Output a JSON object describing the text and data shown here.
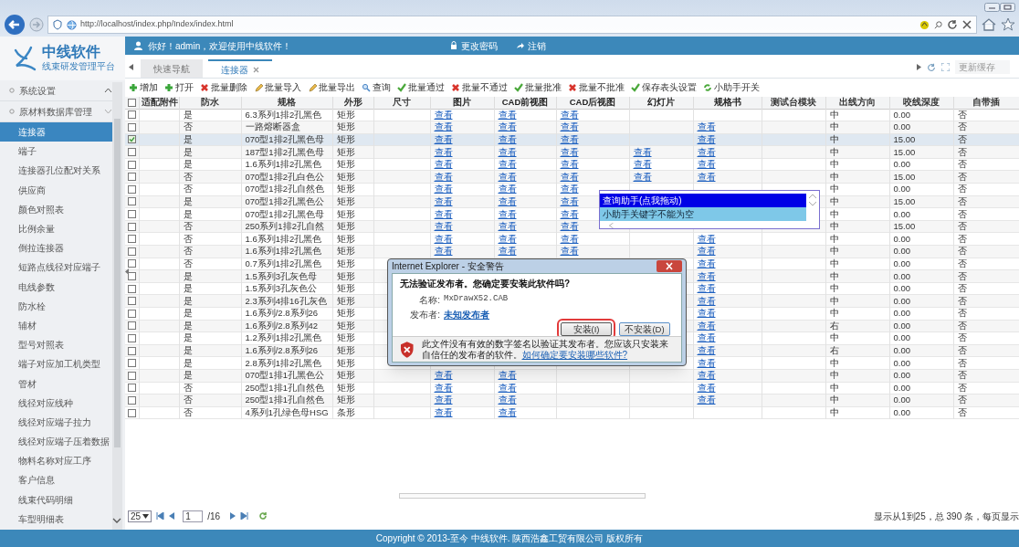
{
  "browser": {
    "url": "http://localhost/index.php/Index/index.html"
  },
  "app": {
    "name": "中线软件",
    "subtitle": "线束研发管理平台"
  },
  "top_bar": {
    "greeting": "你好！admin，欢迎使用中线软件！",
    "links": [
      {
        "label": "更改密码",
        "kind": "password"
      },
      {
        "label": "注销",
        "kind": "logout"
      }
    ]
  },
  "sidebar": {
    "groups": [
      {
        "label": "系统设置",
        "expanded": false
      },
      {
        "label": "原材料数据库管理",
        "expanded": true,
        "children": [
          {
            "label": "连接器",
            "selected": true
          },
          {
            "label": "端子",
            "selected": false
          },
          {
            "label": "连接器孔位配对关系",
            "selected": false
          },
          {
            "label": "供应商",
            "selected": false
          },
          {
            "label": "颜色对照表",
            "selected": false
          },
          {
            "label": "比例余量",
            "selected": false
          },
          {
            "label": "倒拉连接器",
            "selected": false
          },
          {
            "label": "短路点线径对应端子",
            "selected": false
          },
          {
            "label": "电线参数",
            "selected": false
          },
          {
            "label": "防水栓",
            "selected": false
          },
          {
            "label": "辅材",
            "selected": false
          },
          {
            "label": "型号对照表",
            "selected": false
          },
          {
            "label": "端子对应加工机类型",
            "selected": false
          },
          {
            "label": "管材",
            "selected": false
          },
          {
            "label": "线径对应线种",
            "selected": false
          },
          {
            "label": "线径对应端子拉力",
            "selected": false
          },
          {
            "label": "线径对应端子压着数据",
            "selected": false
          },
          {
            "label": "物料名称对应工序",
            "selected": false
          },
          {
            "label": "客户信息",
            "selected": false
          },
          {
            "label": "线束代码明细",
            "selected": false
          },
          {
            "label": "车型明细表",
            "selected": false
          }
        ]
      }
    ]
  },
  "tabs": [
    {
      "label": "快速导航",
      "selected": false,
      "closable": false
    },
    {
      "label": "连接器",
      "selected": true,
      "closable": true
    }
  ],
  "tab_tools": {
    "cache_label": "更新缓存"
  },
  "toolbar": [
    {
      "label": "增加",
      "kind": "add"
    },
    {
      "label": "打开",
      "kind": "add"
    },
    {
      "label": "批量删除",
      "kind": "reject"
    },
    {
      "label": "批量导入",
      "kind": "edit"
    },
    {
      "label": "批量导出",
      "kind": "edit"
    },
    {
      "label": "查询",
      "kind": "query"
    },
    {
      "label": "批量通过",
      "kind": "accept"
    },
    {
      "label": "批量不通过",
      "kind": "reject"
    },
    {
      "label": "批量批准",
      "kind": "accept"
    },
    {
      "label": "批量不批准",
      "kind": "reject"
    },
    {
      "label": "保存表头设置",
      "kind": "accept"
    },
    {
      "label": "小助手开关",
      "kind": "toggle"
    }
  ],
  "table": {
    "select_all_checked": false,
    "columns": [
      {
        "label": "适配附件",
        "kind": "text"
      },
      {
        "label": "防水",
        "kind": "text"
      },
      {
        "label": "规格",
        "kind": "text"
      },
      {
        "label": "外形",
        "kind": "text"
      },
      {
        "label": "尺寸",
        "kind": "text"
      },
      {
        "label": "图片",
        "kind": "link"
      },
      {
        "label": "CAD前视图",
        "kind": "link"
      },
      {
        "label": "CAD后视图",
        "kind": "link"
      },
      {
        "label": "幻灯片",
        "kind": "link"
      },
      {
        "label": "规格书",
        "kind": "link"
      },
      {
        "label": "测试台模块",
        "kind": "text"
      },
      {
        "label": "出线方向",
        "kind": "text"
      },
      {
        "label": "咬线深度",
        "kind": "text"
      },
      {
        "label": "自带插",
        "kind": "text"
      }
    ],
    "rows": [
      {
        "checked": false,
        "cells": [
          null,
          "是",
          "6.3系列1排2孔黑色",
          "矩形",
          null,
          "查看",
          "查看",
          "查看",
          null,
          null,
          null,
          "中",
          "0.00",
          "否"
        ]
      },
      {
        "checked": false,
        "cells": [
          null,
          "否",
          "一路熔断器盒",
          "矩形",
          null,
          "查看",
          "查看",
          "查看",
          null,
          "查看",
          null,
          "中",
          "0.00",
          "否"
        ]
      },
      {
        "checked": true,
        "cells": [
          null,
          "是",
          "070型1排2孔黑色母",
          "矩形",
          null,
          "查看",
          "查看",
          "查看",
          null,
          "查看",
          null,
          "中",
          "15.00",
          "否"
        ]
      },
      {
        "checked": false,
        "cells": [
          null,
          "是",
          "187型1排2孔黑色母",
          "矩形",
          null,
          "查看",
          "查看",
          "查看",
          "查看",
          "查看",
          null,
          "中",
          "15.00",
          "否"
        ]
      },
      {
        "checked": false,
        "cells": [
          null,
          "是",
          "1.6系列1排2孔黑色",
          "矩形",
          null,
          "查看",
          "查看",
          "查看",
          "查看",
          "查看",
          null,
          "中",
          "0.00",
          "否"
        ]
      },
      {
        "checked": false,
        "cells": [
          null,
          "否",
          "070型1排2孔白色公",
          "矩形",
          null,
          "查看",
          "查看",
          "查看",
          "查看",
          "查看",
          null,
          "中",
          "15.00",
          "否"
        ]
      },
      {
        "checked": false,
        "cells": [
          null,
          "否",
          "070型1排2孔自然色",
          "矩形",
          null,
          "查看",
          "查看",
          "查看",
          null,
          null,
          null,
          "中",
          "0.00",
          "否"
        ]
      },
      {
        "checked": false,
        "cells": [
          null,
          "是",
          "070型1排2孔黑色公",
          "矩形",
          null,
          "查看",
          "查看",
          "查看",
          null,
          null,
          null,
          "中",
          "15.00",
          "否"
        ]
      },
      {
        "checked": false,
        "cells": [
          null,
          "是",
          "070型1排2孔黑色母",
          "矩形",
          null,
          "查看",
          "查看",
          "查看",
          null,
          null,
          null,
          "中",
          "0.00",
          "否"
        ]
      },
      {
        "checked": false,
        "cells": [
          null,
          "否",
          "250系列1排2孔自然",
          "矩形",
          null,
          "查看",
          "查看",
          "查看",
          null,
          null,
          null,
          "中",
          "15.00",
          "否"
        ]
      },
      {
        "checked": false,
        "cells": [
          null,
          "否",
          "1.6系列1排2孔黑色",
          "矩形",
          null,
          "查看",
          "查看",
          "查看",
          null,
          "查看",
          null,
          "中",
          "0.00",
          "否"
        ]
      },
      {
        "checked": false,
        "cells": [
          null,
          "否",
          "1.6系列1排2孔黑色",
          "矩形",
          null,
          "查看",
          "查看",
          "查看",
          null,
          "查看",
          null,
          "中",
          "0.00",
          "否"
        ]
      },
      {
        "checked": false,
        "cells": [
          null,
          "否",
          "0.7系列1排2孔黑色",
          "矩形",
          null,
          null,
          null,
          null,
          null,
          "查看",
          null,
          "中",
          "0.00",
          "否"
        ]
      },
      {
        "checked": false,
        "cells": [
          null,
          "是",
          "1.5系列3孔灰色母",
          "矩形",
          null,
          null,
          null,
          null,
          null,
          "查看",
          null,
          "中",
          "0.00",
          "否"
        ]
      },
      {
        "checked": false,
        "cells": [
          null,
          "是",
          "1.5系列3孔灰色公",
          "矩形",
          null,
          null,
          null,
          null,
          null,
          "查看",
          null,
          "中",
          "0.00",
          "否"
        ]
      },
      {
        "checked": false,
        "cells": [
          null,
          "是",
          "2.3系列4排16孔灰色",
          "矩形",
          null,
          null,
          null,
          null,
          null,
          "查看",
          null,
          "中",
          "0.00",
          "否"
        ]
      },
      {
        "checked": false,
        "cells": [
          null,
          "是",
          "1.6系列/2.8系列26",
          "矩形",
          null,
          null,
          null,
          null,
          null,
          "查看",
          null,
          "中",
          "0.00",
          "否"
        ]
      },
      {
        "checked": false,
        "cells": [
          null,
          "是",
          "1.6系列/2.8系列42",
          "矩形",
          null,
          null,
          null,
          null,
          null,
          "查看",
          null,
          "右",
          "0.00",
          "否"
        ]
      },
      {
        "checked": false,
        "cells": [
          null,
          "是",
          "1.2系列1排2孔黑色",
          "矩形",
          null,
          null,
          null,
          null,
          null,
          "查看",
          null,
          "中",
          "0.00",
          "否"
        ]
      },
      {
        "checked": false,
        "cells": [
          null,
          "是",
          "1.6系列/2.8系列26",
          "矩形",
          null,
          null,
          null,
          null,
          null,
          "查看",
          null,
          "右",
          "0.00",
          "否"
        ]
      },
      {
        "checked": false,
        "cells": [
          null,
          "是",
          "2.8系列1排2孔黑色",
          "矩形",
          null,
          null,
          null,
          null,
          null,
          "查看",
          null,
          "中",
          "0.00",
          "否"
        ]
      },
      {
        "checked": false,
        "cells": [
          null,
          "是",
          "070型1排1孔黑色公",
          "矩形",
          null,
          "查看",
          "查看",
          null,
          null,
          "查看",
          null,
          "中",
          "0.00",
          "否"
        ]
      },
      {
        "checked": false,
        "cells": [
          null,
          "否",
          "250型1排1孔自然色",
          "矩形",
          null,
          "查看",
          "查看",
          null,
          null,
          "查看",
          null,
          "中",
          "0.00",
          "否"
        ]
      },
      {
        "checked": false,
        "cells": [
          null,
          "否",
          "250型1排1孔自然色",
          "矩形",
          null,
          "查看",
          "查看",
          null,
          null,
          "查看",
          null,
          "中",
          "0.00",
          "否"
        ]
      },
      {
        "checked": false,
        "cells": [
          null,
          "否",
          "4系列1孔绿色母HSG",
          "条形",
          null,
          "查看",
          "查看",
          null,
          null,
          null,
          null,
          "中",
          "0.00",
          "否"
        ]
      }
    ]
  },
  "pager": {
    "page_size": "25",
    "page": "1",
    "page_count": "/16",
    "summary": "显示从1到25，总 390 条，每页显示"
  },
  "helper_popup": {
    "items": [
      {
        "label": "查询助手(点我拖动)",
        "selected": true
      },
      {
        "label": "小助手关键字不能为空",
        "selected": false
      }
    ]
  },
  "dialog": {
    "title": "Internet Explorer - 安全警告",
    "heading": "无法验证发布者。您确定要安装此软件吗?",
    "name_label": "名称:",
    "name_value": "MxDrawX52.CAB",
    "publisher_label": "发布者:",
    "publisher_value": "未知发布者",
    "buttons": [
      {
        "label": "安装(I)",
        "focused": true
      },
      {
        "label": "不安装(D)",
        "focused": false
      }
    ],
    "warning": "此文件没有有效的数字签名以验证其发布者。您应该只安装来自信任的发布者的软件。",
    "help_link": "如何确定要安装哪些软件?"
  },
  "footer": "Copyright © 2013-至今 中线软件. 陕西浩鑫工贸有限公司 版权所有"
}
